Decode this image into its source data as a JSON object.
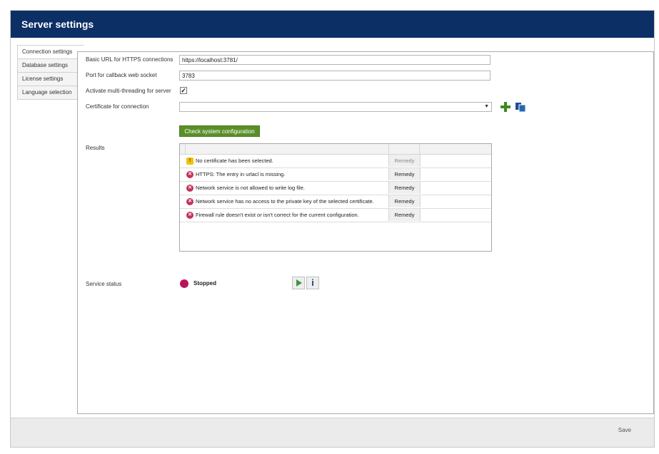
{
  "window": {
    "title": "Server settings"
  },
  "tabs": [
    {
      "label": "Connection settings",
      "active": true
    },
    {
      "label": "Database settings",
      "active": false
    },
    {
      "label": "License settings",
      "active": false
    },
    {
      "label": "Language selection",
      "active": false
    }
  ],
  "form": {
    "base_url_label": "Basic URL for HTTPS connections",
    "base_url_value": "https://localhost:3781/",
    "port_label": "Port for callback web socket",
    "port_value": "3783",
    "multithread_label": "Activate multi-threading for server",
    "multithread_checked": true,
    "certificate_label": "Certificate for connection",
    "certificate_value": "",
    "add_icon": "plus-icon",
    "copy_icon": "copy-icon"
  },
  "check_button": "Check system configuration",
  "results": {
    "label": "Results",
    "rows": [
      {
        "type": "warning",
        "icon_glyph": "!",
        "message": "No certificate has been selected.",
        "remedy": "Remedy",
        "remedy_enabled": false
      },
      {
        "type": "error",
        "icon_glyph": "✕",
        "message": "HTTPS: The entry in urlacl is missing.",
        "remedy": "Remedy",
        "remedy_enabled": true
      },
      {
        "type": "error",
        "icon_glyph": "✕",
        "message": "Network service is not allowed to write log file.",
        "remedy": "Remedy",
        "remedy_enabled": true
      },
      {
        "type": "error",
        "icon_glyph": "✕",
        "message": "Network service has no access to the private key of the selected certificate.",
        "remedy": "Remedy",
        "remedy_enabled": true
      },
      {
        "type": "error",
        "icon_glyph": "✕",
        "message": "Firewall rule doesn't exist or isn't correct for the current configuration.",
        "remedy": "Remedy",
        "remedy_enabled": true
      }
    ]
  },
  "service": {
    "label": "Service status",
    "status": "Stopped",
    "status_color": "#b8145a",
    "start_icon": "play-icon",
    "info_icon": "info-icon",
    "info_glyph": "i"
  },
  "footer": {
    "save_label": "Save"
  },
  "colors": {
    "titlebar": "#0c2f66",
    "accent_green": "#5a8f28"
  }
}
